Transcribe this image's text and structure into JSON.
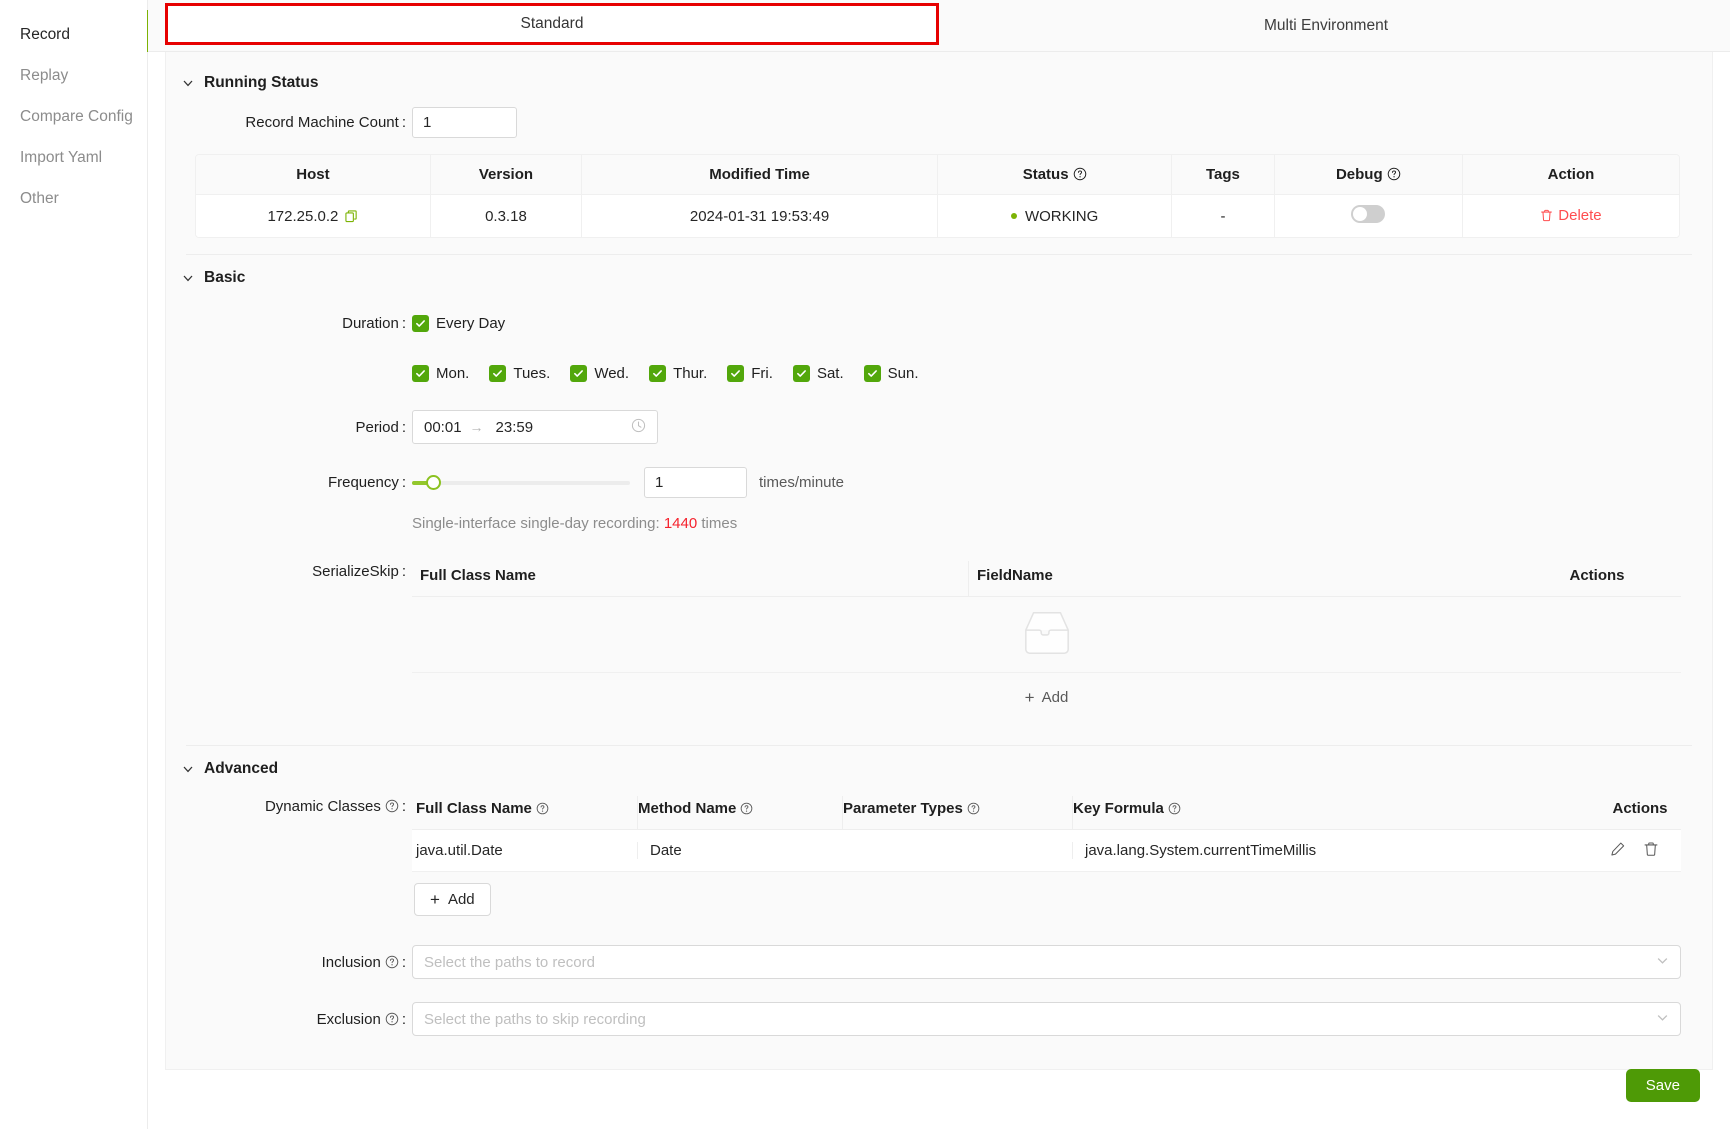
{
  "sidebar": {
    "items": [
      {
        "label": "Record",
        "active": true
      },
      {
        "label": "Replay",
        "active": false
      },
      {
        "label": "Compare Config",
        "active": false
      },
      {
        "label": "Import Yaml",
        "active": false
      },
      {
        "label": "Other",
        "active": false
      }
    ]
  },
  "tabs": [
    {
      "label": "Standard",
      "selected": true
    },
    {
      "label": "Multi Environment",
      "selected": false
    }
  ],
  "running_status": {
    "title": "Running Status",
    "record_machine_count_label": "Record Machine Count",
    "record_machine_count_value": "1",
    "table": {
      "columns": [
        "Host",
        "Version",
        "Modified Time",
        "Status",
        "Tags",
        "Debug",
        "Action"
      ],
      "help_columns": [
        "Status",
        "Debug"
      ],
      "rows": [
        {
          "host": "172.25.0.2",
          "version": "0.3.18",
          "modified_time": "2024-01-31 19:53:49",
          "status": "WORKING",
          "tags": "-",
          "debug_enabled": false,
          "action": "Delete"
        }
      ]
    }
  },
  "basic": {
    "title": "Basic",
    "duration_label": "Duration",
    "every_day_label": "Every Day",
    "every_day_checked": true,
    "days": [
      {
        "label": "Mon.",
        "checked": true
      },
      {
        "label": "Tues.",
        "checked": true
      },
      {
        "label": "Wed.",
        "checked": true
      },
      {
        "label": "Thur.",
        "checked": true
      },
      {
        "label": "Fri.",
        "checked": true
      },
      {
        "label": "Sat.",
        "checked": true
      },
      {
        "label": "Sun.",
        "checked": true
      }
    ],
    "period_label": "Period",
    "period_start": "00:01",
    "period_arrow": "→",
    "period_end": "23:59",
    "frequency_label": "Frequency",
    "frequency_value": "1",
    "frequency_unit": "times/minute",
    "hint_prefix": "Single-interface single-day recording:",
    "hint_number": "1440",
    "hint_suffix": "times",
    "serialize_skip_label": "SerializeSkip",
    "serialize_table": {
      "columns": [
        "Full Class Name",
        "FieldName",
        "Actions"
      ],
      "rows": []
    },
    "add_label": "Add"
  },
  "advanced": {
    "title": "Advanced",
    "dynamic_classes_label": "Dynamic Classes",
    "dynamic_table": {
      "columns": [
        "Full Class Name",
        "Method Name",
        "Parameter Types",
        "Key Formula",
        "Actions"
      ],
      "rows": [
        {
          "full_class_name": "java.util.Date",
          "method_name": "Date",
          "parameter_types": "",
          "key_formula": "java.lang.System.currentTimeMillis"
        }
      ]
    },
    "add_label": "Add",
    "inclusion_label": "Inclusion",
    "inclusion_placeholder": "Select the paths to record",
    "exclusion_label": "Exclusion",
    "exclusion_placeholder": "Select the paths to skip recording"
  },
  "footer": {
    "save_label": "Save"
  },
  "colors": {
    "accent_green": "#52a70b",
    "save_green": "#4e9a06",
    "status_green": "#7cb305",
    "danger_red": "#ff4d4f",
    "hint_red": "#f5222d",
    "tab_highlight": "#e60000"
  }
}
